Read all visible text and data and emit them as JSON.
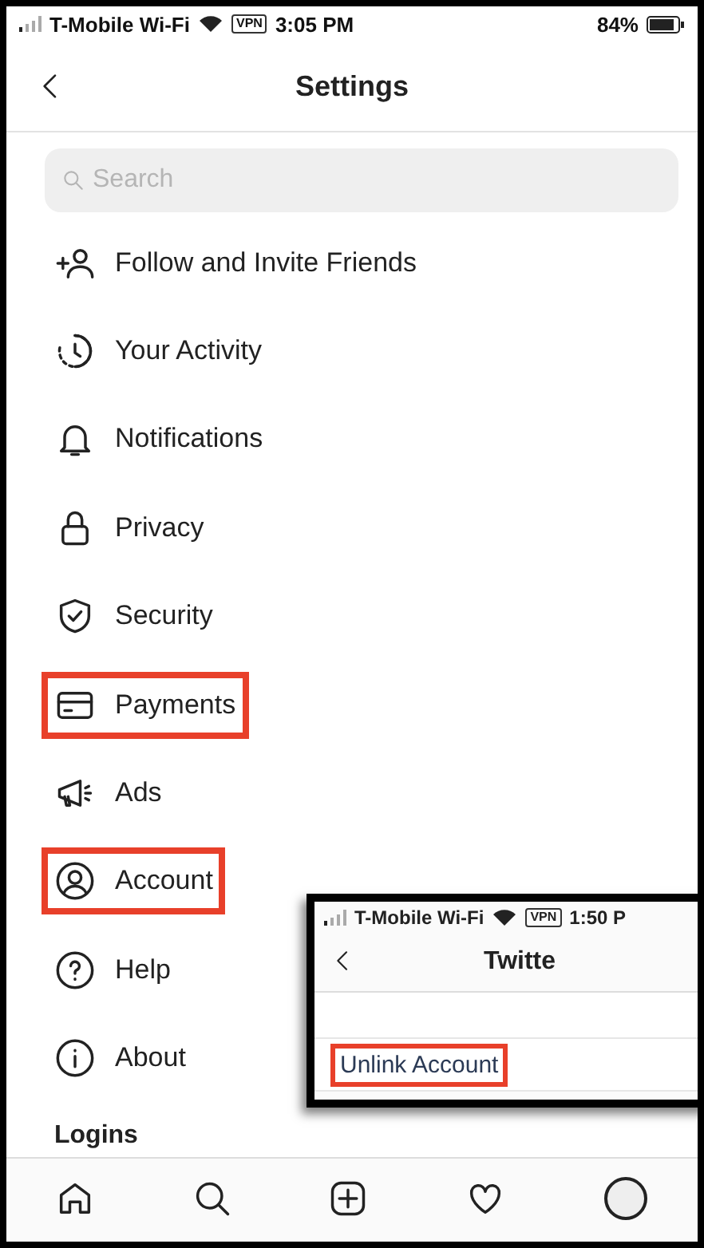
{
  "status_bar": {
    "carrier": "T-Mobile Wi-Fi",
    "vpn": "VPN",
    "time": "3:05 PM",
    "battery": "84%"
  },
  "header": {
    "title": "Settings"
  },
  "search": {
    "placeholder": "Search"
  },
  "items": [
    {
      "label": "Follow and Invite Friends",
      "highlighted": false
    },
    {
      "label": "Your Activity",
      "highlighted": false
    },
    {
      "label": "Notifications",
      "highlighted": false
    },
    {
      "label": "Privacy",
      "highlighted": false
    },
    {
      "label": "Security",
      "highlighted": false
    },
    {
      "label": "Payments",
      "highlighted": true
    },
    {
      "label": "Ads",
      "highlighted": false
    },
    {
      "label": "Account",
      "highlighted": true
    },
    {
      "label": "Help",
      "highlighted": false
    },
    {
      "label": "About",
      "highlighted": false
    }
  ],
  "section_title": "Logins",
  "inset": {
    "status_bar": {
      "carrier": "T-Mobile Wi-Fi",
      "vpn": "VPN",
      "time": "1:50 P"
    },
    "title": "Twitte",
    "action": {
      "label": "Unlink Account",
      "highlighted": true
    }
  }
}
